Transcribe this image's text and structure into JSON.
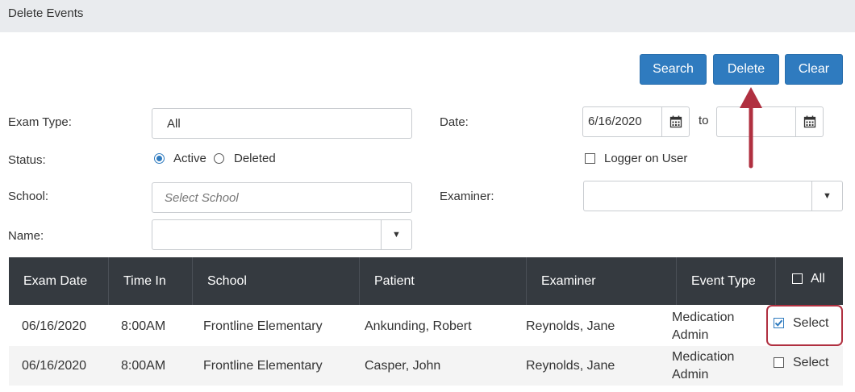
{
  "header": {
    "title": "Delete Events"
  },
  "toolbar": {
    "search_label": "Search",
    "delete_label": "Delete",
    "clear_label": "Clear"
  },
  "filters": {
    "exam_type_label": "Exam Type:",
    "exam_type_value": "All",
    "status_label": "Status:",
    "status_active": "Active",
    "status_deleted": "Deleted",
    "status_selected": "Active",
    "school_label": "School:",
    "school_placeholder": "Select School",
    "name_label": "Name:",
    "name_value": "",
    "date_label": "Date:",
    "date_from": "6/16/2020",
    "date_to_label": "to",
    "date_to": "",
    "logger_label": "Logger on User",
    "logger_checked": false,
    "examiner_label": "Examiner:",
    "examiner_value": ""
  },
  "table": {
    "columns": [
      "Exam Date",
      "Time In",
      "School",
      "Patient",
      "Examiner",
      "Event Type",
      "All"
    ],
    "rows": [
      {
        "exam_date": "06/16/2020",
        "time_in": "8:00AM",
        "school": "Frontline Elementary",
        "patient": "Ankunding, Robert",
        "examiner": "Reynolds, Jane",
        "event_type_1": "Medication",
        "event_type_2": "Admin",
        "select_label": "Select",
        "selected": true
      },
      {
        "exam_date": "06/16/2020",
        "time_in": "8:00AM",
        "school": "Frontline Elementary",
        "patient": "Casper, John",
        "examiner": "Reynolds, Jane",
        "event_type_1": "Medication",
        "event_type_2": "Admin",
        "select_label": "Select",
        "selected": false
      }
    ]
  },
  "colors": {
    "accent": "#2f7bbf",
    "header_bg": "#353a40",
    "highlight": "#b03040",
    "title_bg": "#e9ebee"
  },
  "icons": {
    "calendar": "calendar-icon",
    "dropdown": "chevron-down-icon",
    "annotation": "red-arrow-up"
  }
}
